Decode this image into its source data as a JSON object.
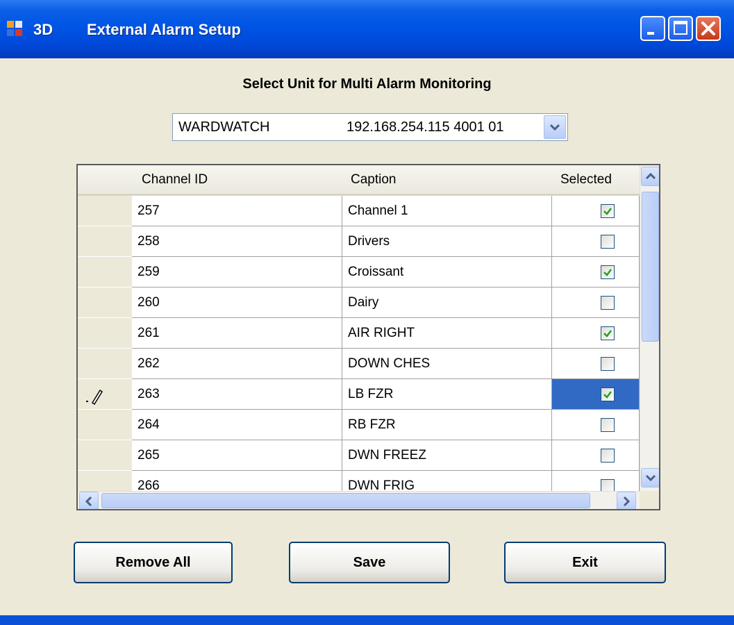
{
  "window": {
    "title_prefix": "3D",
    "title": "External Alarm Setup"
  },
  "heading": "Select Unit for Multi Alarm Monitoring",
  "unit_select": {
    "name": "WARDWATCH",
    "address": "192.168.254.115 4001 01"
  },
  "table": {
    "columns": [
      "Channel ID",
      "Caption",
      "Selected"
    ],
    "rows": [
      {
        "id": "257",
        "caption": "Channel 1",
        "selected": true
      },
      {
        "id": "258",
        "caption": "Drivers",
        "selected": false
      },
      {
        "id": "259",
        "caption": "Croissant",
        "selected": true
      },
      {
        "id": "260",
        "caption": "Dairy",
        "selected": false
      },
      {
        "id": "261",
        "caption": "AIR RIGHT",
        "selected": true
      },
      {
        "id": "262",
        "caption": "DOWN CHES",
        "selected": false
      },
      {
        "id": "263",
        "caption": "LB FZR",
        "selected": true,
        "editing": true
      },
      {
        "id": "264",
        "caption": "RB FZR",
        "selected": false
      },
      {
        "id": "265",
        "caption": "DWN FREEZ",
        "selected": false
      },
      {
        "id": "266",
        "caption": "DWN FRIG",
        "selected": false
      }
    ]
  },
  "buttons": {
    "remove_all": "Remove All",
    "save": "Save",
    "exit": "Exit"
  },
  "colors": {
    "titlebar": "#0055e5",
    "selection": "#316ac5",
    "check": "#21a121"
  }
}
